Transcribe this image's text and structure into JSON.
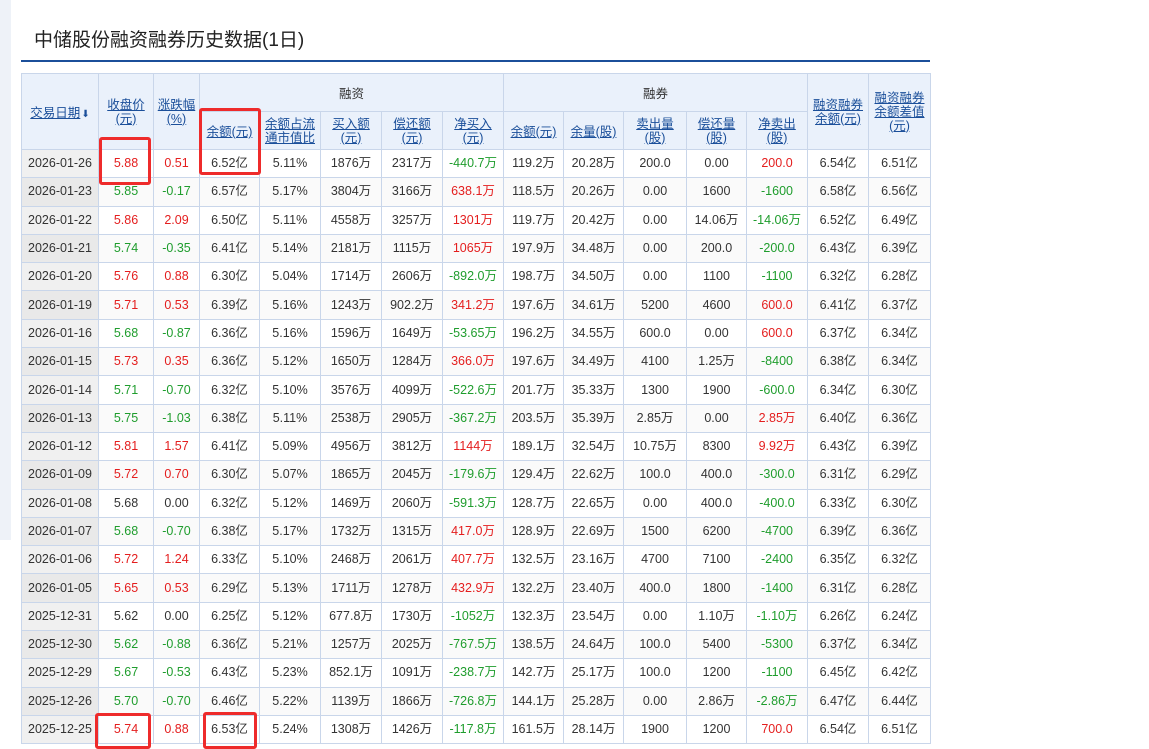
{
  "page": {
    "title": "中储股份融资融券历史数据(1日)"
  },
  "table": {
    "headers": {
      "date": "交易日期",
      "close": [
        "收盘价",
        "(元)"
      ],
      "change": [
        "涨跌幅",
        "(%)"
      ],
      "rz_group": "融资",
      "rq_group": "融券",
      "rz_balance": "余额(元)",
      "rz_ratio": [
        "余额占流",
        "通市值比"
      ],
      "rz_buy": [
        "买入额",
        "(元)"
      ],
      "rz_repay": [
        "偿还额",
        "(元)"
      ],
      "rz_net": [
        "净买入",
        "(元)"
      ],
      "rq_balance": "余额(元)",
      "rq_volume": "余量(股)",
      "rq_sell": [
        "卖出量",
        "(股)"
      ],
      "rq_repay": [
        "偿还量",
        "(股)"
      ],
      "rq_net": [
        "净卖出",
        "(股)"
      ],
      "total": [
        "融资融券",
        "余额(元)"
      ],
      "diff": [
        "融资融券",
        "余额差值",
        "(元)"
      ]
    },
    "rows": [
      {
        "date": "2026-01-26",
        "close": "5.88",
        "chg": "0.51",
        "rz": "6.52亿",
        "ratio": "5.11%",
        "buy": "1876万",
        "repay": "2317万",
        "net": "-440.7万",
        "rq": "119.2万",
        "vol": "20.28万",
        "sell": "200.0",
        "rqrepay": "0.00",
        "rqnet": "200.0",
        "total": "6.54亿",
        "diff": "6.51亿",
        "cc": "red",
        "nc": "green",
        "rc": "red"
      },
      {
        "date": "2026-01-23",
        "close": "5.85",
        "chg": "-0.17",
        "rz": "6.57亿",
        "ratio": "5.17%",
        "buy": "3804万",
        "repay": "3166万",
        "net": "638.1万",
        "rq": "118.5万",
        "vol": "20.26万",
        "sell": "0.00",
        "rqrepay": "1600",
        "rqnet": "-1600",
        "total": "6.58亿",
        "diff": "6.56亿",
        "cc": "green",
        "nc": "red",
        "rc": "green"
      },
      {
        "date": "2026-01-22",
        "close": "5.86",
        "chg": "2.09",
        "rz": "6.50亿",
        "ratio": "5.11%",
        "buy": "4558万",
        "repay": "3257万",
        "net": "1301万",
        "rq": "119.7万",
        "vol": "20.42万",
        "sell": "0.00",
        "rqrepay": "14.06万",
        "rqnet": "-14.06万",
        "total": "6.52亿",
        "diff": "6.49亿",
        "cc": "red",
        "nc": "red",
        "rc": "green"
      },
      {
        "date": "2026-01-21",
        "close": "5.74",
        "chg": "-0.35",
        "rz": "6.41亿",
        "ratio": "5.14%",
        "buy": "2181万",
        "repay": "1115万",
        "net": "1065万",
        "rq": "197.9万",
        "vol": "34.48万",
        "sell": "0.00",
        "rqrepay": "200.0",
        "rqnet": "-200.0",
        "total": "6.43亿",
        "diff": "6.39亿",
        "cc": "green",
        "nc": "red",
        "rc": "green"
      },
      {
        "date": "2026-01-20",
        "close": "5.76",
        "chg": "0.88",
        "rz": "6.30亿",
        "ratio": "5.04%",
        "buy": "1714万",
        "repay": "2606万",
        "net": "-892.0万",
        "rq": "198.7万",
        "vol": "34.50万",
        "sell": "0.00",
        "rqrepay": "1100",
        "rqnet": "-1100",
        "total": "6.32亿",
        "diff": "6.28亿",
        "cc": "red",
        "nc": "green",
        "rc": "green"
      },
      {
        "date": "2026-01-19",
        "close": "5.71",
        "chg": "0.53",
        "rz": "6.39亿",
        "ratio": "5.16%",
        "buy": "1243万",
        "repay": "902.2万",
        "net": "341.2万",
        "rq": "197.6万",
        "vol": "34.61万",
        "sell": "5200",
        "rqrepay": "4600",
        "rqnet": "600.0",
        "total": "6.41亿",
        "diff": "6.37亿",
        "cc": "red",
        "nc": "red",
        "rc": "red"
      },
      {
        "date": "2026-01-16",
        "close": "5.68",
        "chg": "-0.87",
        "rz": "6.36亿",
        "ratio": "5.16%",
        "buy": "1596万",
        "repay": "1649万",
        "net": "-53.65万",
        "rq": "196.2万",
        "vol": "34.55万",
        "sell": "600.0",
        "rqrepay": "0.00",
        "rqnet": "600.0",
        "total": "6.37亿",
        "diff": "6.34亿",
        "cc": "green",
        "nc": "green",
        "rc": "red"
      },
      {
        "date": "2026-01-15",
        "close": "5.73",
        "chg": "0.35",
        "rz": "6.36亿",
        "ratio": "5.12%",
        "buy": "1650万",
        "repay": "1284万",
        "net": "366.0万",
        "rq": "197.6万",
        "vol": "34.49万",
        "sell": "4100",
        "rqrepay": "1.25万",
        "rqnet": "-8400",
        "total": "6.38亿",
        "diff": "6.34亿",
        "cc": "red",
        "nc": "red",
        "rc": "green"
      },
      {
        "date": "2026-01-14",
        "close": "5.71",
        "chg": "-0.70",
        "rz": "6.32亿",
        "ratio": "5.10%",
        "buy": "3576万",
        "repay": "4099万",
        "net": "-522.6万",
        "rq": "201.7万",
        "vol": "35.33万",
        "sell": "1300",
        "rqrepay": "1900",
        "rqnet": "-600.0",
        "total": "6.34亿",
        "diff": "6.30亿",
        "cc": "green",
        "nc": "green",
        "rc": "green"
      },
      {
        "date": "2026-01-13",
        "close": "5.75",
        "chg": "-1.03",
        "rz": "6.38亿",
        "ratio": "5.11%",
        "buy": "2538万",
        "repay": "2905万",
        "net": "-367.2万",
        "rq": "203.5万",
        "vol": "35.39万",
        "sell": "2.85万",
        "rqrepay": "0.00",
        "rqnet": "2.85万",
        "total": "6.40亿",
        "diff": "6.36亿",
        "cc": "green",
        "nc": "green",
        "rc": "red"
      },
      {
        "date": "2026-01-12",
        "close": "5.81",
        "chg": "1.57",
        "rz": "6.41亿",
        "ratio": "5.09%",
        "buy": "4956万",
        "repay": "3812万",
        "net": "1144万",
        "rq": "189.1万",
        "vol": "32.54万",
        "sell": "10.75万",
        "rqrepay": "8300",
        "rqnet": "9.92万",
        "total": "6.43亿",
        "diff": "6.39亿",
        "cc": "red",
        "nc": "red",
        "rc": "red"
      },
      {
        "date": "2026-01-09",
        "close": "5.72",
        "chg": "0.70",
        "rz": "6.30亿",
        "ratio": "5.07%",
        "buy": "1865万",
        "repay": "2045万",
        "net": "-179.6万",
        "rq": "129.4万",
        "vol": "22.62万",
        "sell": "100.0",
        "rqrepay": "400.0",
        "rqnet": "-300.0",
        "total": "6.31亿",
        "diff": "6.29亿",
        "cc": "red",
        "nc": "green",
        "rc": "green"
      },
      {
        "date": "2026-01-08",
        "close": "5.68",
        "chg": "0.00",
        "rz": "6.32亿",
        "ratio": "5.12%",
        "buy": "1469万",
        "repay": "2060万",
        "net": "-591.3万",
        "rq": "128.7万",
        "vol": "22.65万",
        "sell": "0.00",
        "rqrepay": "400.0",
        "rqnet": "-400.0",
        "total": "6.33亿",
        "diff": "6.30亿",
        "cc": "blk",
        "nc": "green",
        "rc": "green"
      },
      {
        "date": "2026-01-07",
        "close": "5.68",
        "chg": "-0.70",
        "rz": "6.38亿",
        "ratio": "5.17%",
        "buy": "1732万",
        "repay": "1315万",
        "net": "417.0万",
        "rq": "128.9万",
        "vol": "22.69万",
        "sell": "1500",
        "rqrepay": "6200",
        "rqnet": "-4700",
        "total": "6.39亿",
        "diff": "6.36亿",
        "cc": "green",
        "nc": "red",
        "rc": "green"
      },
      {
        "date": "2026-01-06",
        "close": "5.72",
        "chg": "1.24",
        "rz": "6.33亿",
        "ratio": "5.10%",
        "buy": "2468万",
        "repay": "2061万",
        "net": "407.7万",
        "rq": "132.5万",
        "vol": "23.16万",
        "sell": "4700",
        "rqrepay": "7100",
        "rqnet": "-2400",
        "total": "6.35亿",
        "diff": "6.32亿",
        "cc": "red",
        "nc": "red",
        "rc": "green"
      },
      {
        "date": "2026-01-05",
        "close": "5.65",
        "chg": "0.53",
        "rz": "6.29亿",
        "ratio": "5.13%",
        "buy": "1711万",
        "repay": "1278万",
        "net": "432.9万",
        "rq": "132.2万",
        "vol": "23.40万",
        "sell": "400.0",
        "rqrepay": "1800",
        "rqnet": "-1400",
        "total": "6.31亿",
        "diff": "6.28亿",
        "cc": "red",
        "nc": "red",
        "rc": "green"
      },
      {
        "date": "2025-12-31",
        "close": "5.62",
        "chg": "0.00",
        "rz": "6.25亿",
        "ratio": "5.12%",
        "buy": "677.8万",
        "repay": "1730万",
        "net": "-1052万",
        "rq": "132.3万",
        "vol": "23.54万",
        "sell": "0.00",
        "rqrepay": "1.10万",
        "rqnet": "-1.10万",
        "total": "6.26亿",
        "diff": "6.24亿",
        "cc": "blk",
        "nc": "green",
        "rc": "green"
      },
      {
        "date": "2025-12-30",
        "close": "5.62",
        "chg": "-0.88",
        "rz": "6.36亿",
        "ratio": "5.21%",
        "buy": "1257万",
        "repay": "2025万",
        "net": "-767.5万",
        "rq": "138.5万",
        "vol": "24.64万",
        "sell": "100.0",
        "rqrepay": "5400",
        "rqnet": "-5300",
        "total": "6.37亿",
        "diff": "6.34亿",
        "cc": "green",
        "nc": "green",
        "rc": "green"
      },
      {
        "date": "2025-12-29",
        "close": "5.67",
        "chg": "-0.53",
        "rz": "6.43亿",
        "ratio": "5.23%",
        "buy": "852.1万",
        "repay": "1091万",
        "net": "-238.7万",
        "rq": "142.7万",
        "vol": "25.17万",
        "sell": "100.0",
        "rqrepay": "1200",
        "rqnet": "-1100",
        "total": "6.45亿",
        "diff": "6.42亿",
        "cc": "green",
        "nc": "green",
        "rc": "green"
      },
      {
        "date": "2025-12-26",
        "close": "5.70",
        "chg": "-0.70",
        "rz": "6.46亿",
        "ratio": "5.22%",
        "buy": "1139万",
        "repay": "1866万",
        "net": "-726.8万",
        "rq": "144.1万",
        "vol": "25.28万",
        "sell": "0.00",
        "rqrepay": "2.86万",
        "rqnet": "-2.86万",
        "total": "6.47亿",
        "diff": "6.44亿",
        "cc": "green",
        "nc": "green",
        "rc": "green"
      },
      {
        "date": "2025-12-25",
        "close": "5.74",
        "chg": "0.88",
        "rz": "6.53亿",
        "ratio": "5.24%",
        "buy": "1308万",
        "repay": "1426万",
        "net": "-117.8万",
        "rq": "161.5万",
        "vol": "28.14万",
        "sell": "1900",
        "rqrepay": "1200",
        "rqnet": "700.0",
        "total": "6.54亿",
        "diff": "6.51亿",
        "cc": "red",
        "nc": "green",
        "rc": "red"
      }
    ]
  },
  "colors": {
    "up": "#e41e1e",
    "down": "#1f9d2d",
    "highlight": "#ee2b2b",
    "link": "#1b4f9a"
  }
}
